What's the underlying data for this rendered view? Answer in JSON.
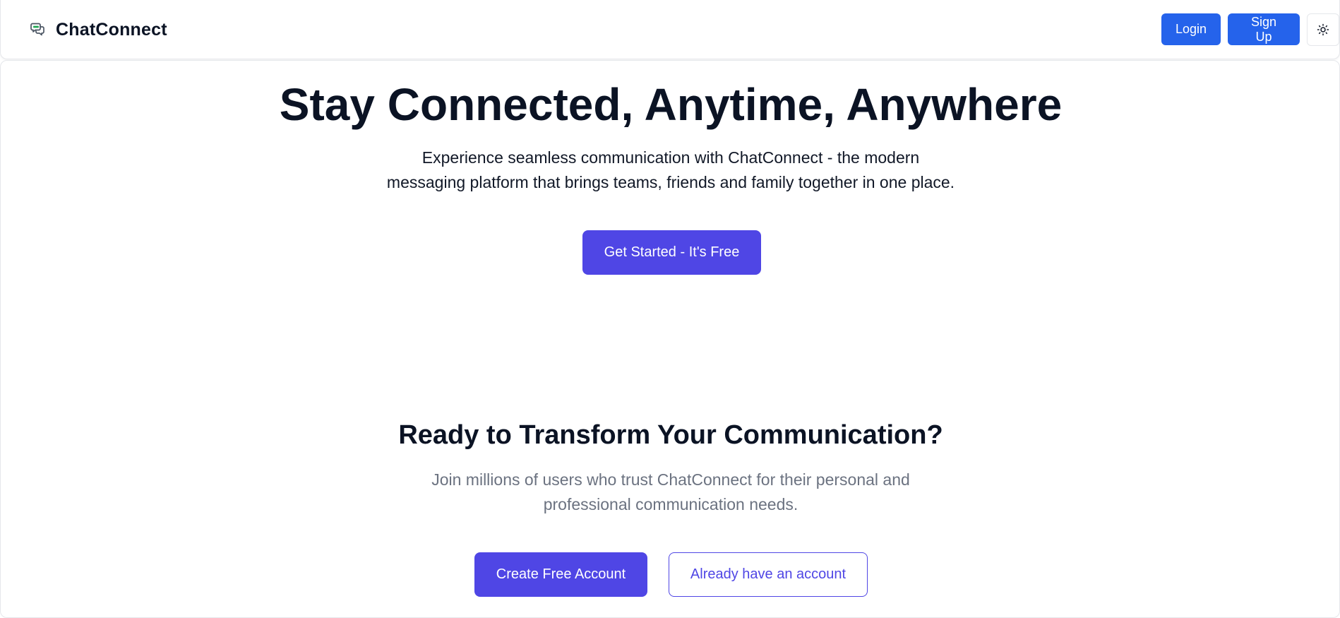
{
  "header": {
    "brand_name": "ChatConnect",
    "brand_icon": "chat-bubbles-icon",
    "login_label": "Login",
    "signup_label": "Sign Up",
    "theme_icon": "sun-icon"
  },
  "hero": {
    "title": "Stay Connected, Anytime, Anywhere",
    "subtitle": "Experience seamless communication with ChatConnect - the modern messaging platform that brings teams, friends and family together in one place.",
    "cta_label": "Get Started - It's Free"
  },
  "cta_section": {
    "title": "Ready to Transform Your Communication?",
    "subtitle": "Join millions of users who trust ChatConnect for their personal and professional communication needs.",
    "create_account_label": "Create Free Account",
    "existing_account_label": "Already have an account"
  },
  "colors": {
    "header_button": "#2563eb",
    "accent": "#4f46e5",
    "heading": "#0b1324",
    "muted_text": "#6b7280",
    "border": "#e5e7eb"
  }
}
